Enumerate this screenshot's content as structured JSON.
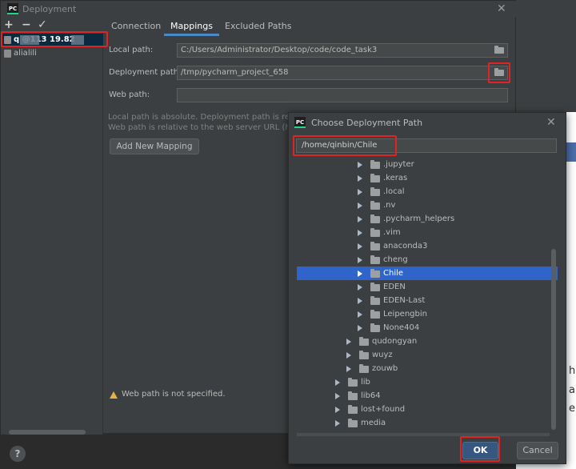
{
  "deployment": {
    "title": "Deployment",
    "toolbar": {
      "add": "+",
      "remove": "−",
      "apply": "✓"
    },
    "servers": [
      {
        "label": "q      @113      19.82"
      },
      {
        "label": "alialili"
      }
    ],
    "tabs": [
      {
        "label": "Connection"
      },
      {
        "label": "Mappings"
      },
      {
        "label": "Excluded Paths"
      }
    ],
    "local_path": {
      "label": "Local path:",
      "value": "C:/Users/Administrator/Desktop/code/code_task3"
    },
    "deployment_path": {
      "label": "Deployment path:",
      "value": "/tmp/pycharm_project_658"
    },
    "web_path": {
      "label": "Web path:",
      "value": ""
    },
    "note_line1": "Local path is absolute. Deployment path is relat",
    "note_line2": "Web path is relative to the web server URL (http",
    "add_mapping": "Add New Mapping",
    "warning": "Web path is not specified.",
    "help": "?"
  },
  "choose_dialog": {
    "title": "Choose Deployment Path",
    "path": "/home/qinbin/Chile",
    "items": [
      {
        "label": ".jupyter",
        "level": 2
      },
      {
        "label": ".keras",
        "level": 2
      },
      {
        "label": ".local",
        "level": 2
      },
      {
        "label": ".nv",
        "level": 2
      },
      {
        "label": ".pycharm_helpers",
        "level": 2
      },
      {
        "label": ".vim",
        "level": 2
      },
      {
        "label": "anaconda3",
        "level": 2
      },
      {
        "label": "cheng",
        "level": 2
      },
      {
        "label": "Chile",
        "level": 2,
        "selected": true
      },
      {
        "label": "EDEN",
        "level": 2
      },
      {
        "label": "EDEN-Last",
        "level": 2
      },
      {
        "label": "Leipengbin",
        "level": 2
      },
      {
        "label": "None404",
        "level": 2
      },
      {
        "label": "qudongyan",
        "level": 1
      },
      {
        "label": "wuyz",
        "level": 1
      },
      {
        "label": "zouwb",
        "level": 1
      },
      {
        "label": "lib",
        "level": 0
      },
      {
        "label": "lib64",
        "level": 0
      },
      {
        "label": "lost+found",
        "level": 0
      },
      {
        "label": "media",
        "level": 0
      }
    ],
    "ok": "OK",
    "cancel": "Cancel"
  },
  "background_fragments": [
    "h",
    "a",
    "e"
  ],
  "colors": {
    "dialog_bg": "#3c3f41",
    "selection": "#2f65ca",
    "highlight": "#e02424",
    "accent": "#4a88c7"
  }
}
